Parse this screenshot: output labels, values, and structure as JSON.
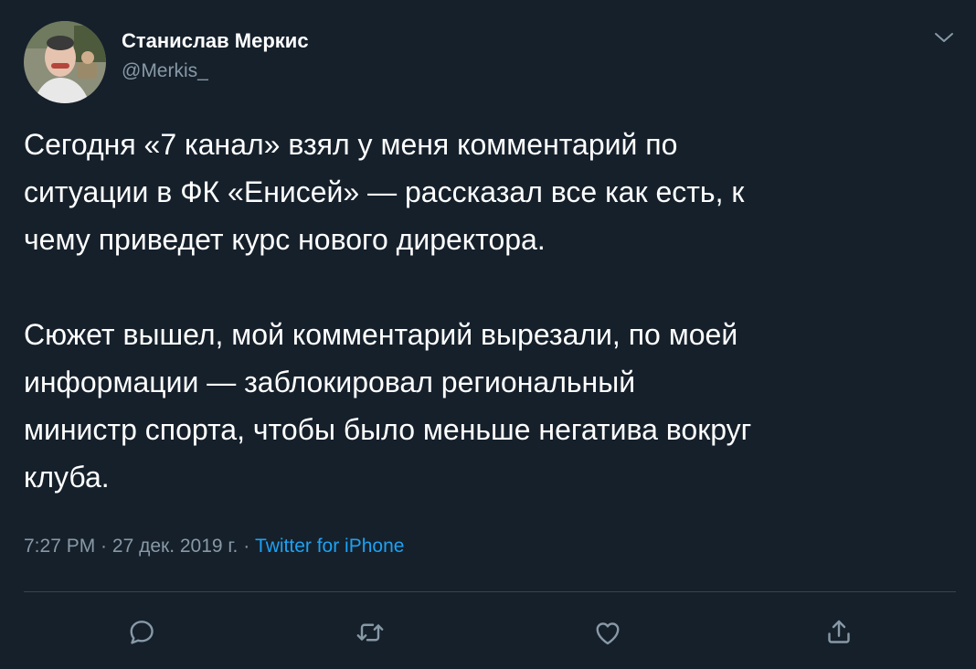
{
  "author": {
    "name": "Станислав Меркис",
    "handle": "@Merkis_",
    "avatar_icon": "user-photo-avatar"
  },
  "header": {
    "menu_icon": "chevron-down-icon"
  },
  "tweet": {
    "paragraphs": [
      "Сегодня «7 канал» взял у меня комментарий по\nситуации в ФК «Енисей» — рассказал все как есть, к\nчему приведет курс нового директора.",
      "Сюжет вышел, мой комментарий вырезали, по моей\nинформации — заблокировал региональный\nминистр спорта, чтобы было меньше негатива вокруг\nклуба."
    ]
  },
  "meta": {
    "time": "7:27 PM",
    "separator": " · ",
    "date": "27 дек. 2019 г.",
    "source": "Twitter for iPhone"
  },
  "actions": [
    {
      "icon": "reply-icon"
    },
    {
      "icon": "retweet-icon"
    },
    {
      "icon": "like-icon"
    },
    {
      "icon": "share-icon"
    }
  ],
  "colors": {
    "background": "#15202b",
    "text": "#ffffff",
    "secondary": "#8899a6",
    "accent": "#1da1f2",
    "divider": "#38444d"
  }
}
